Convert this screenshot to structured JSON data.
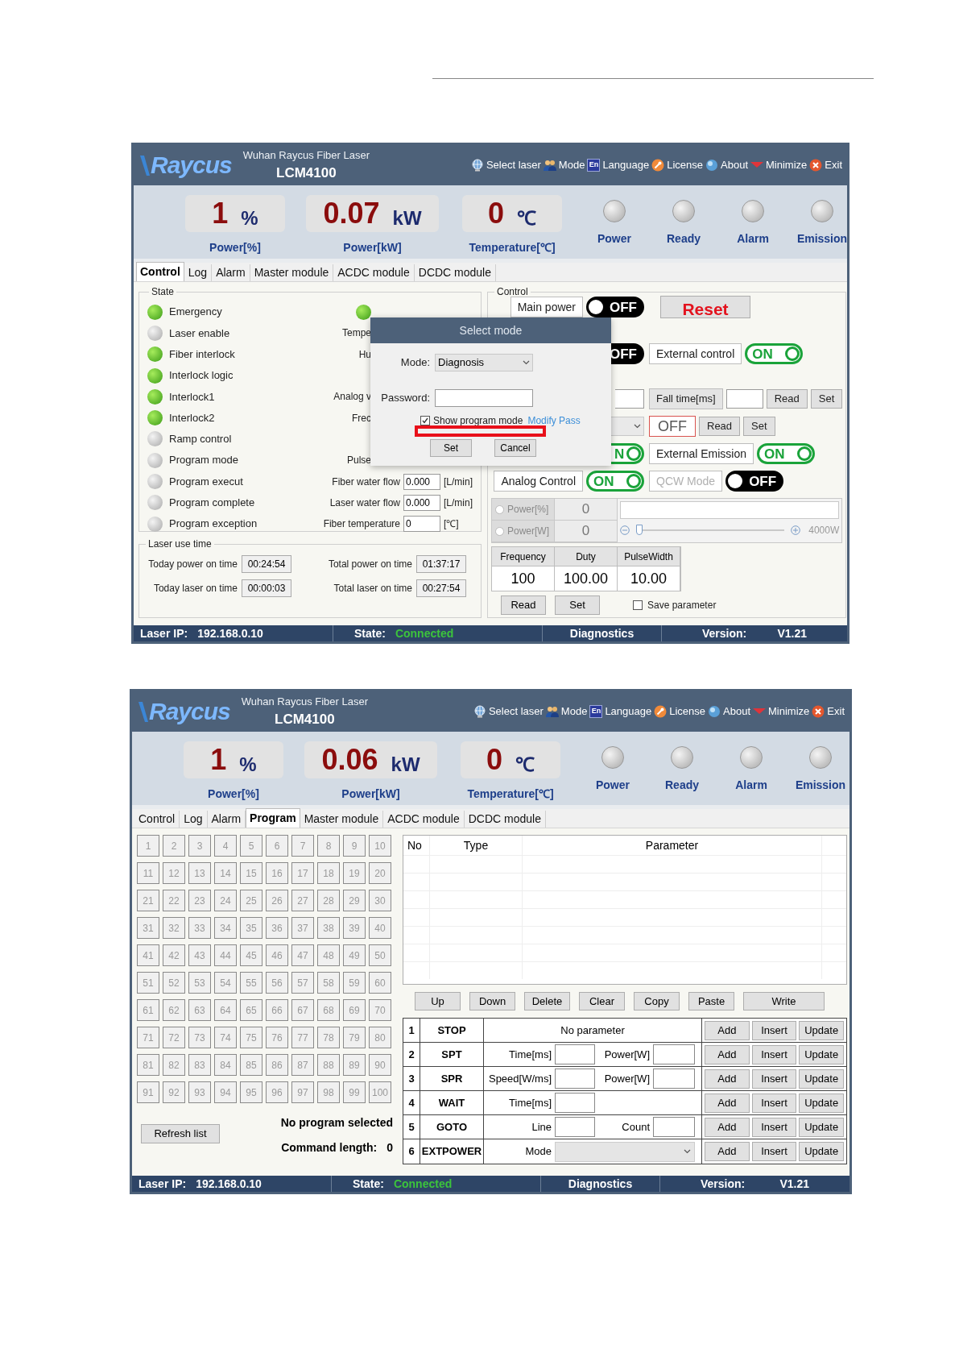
{
  "screens": [
    {
      "kind": "control",
      "header": {
        "logo": "Raycus",
        "company": "Wuhan Raycus Fiber Laser",
        "model": "LCM4100",
        "menu": [
          {
            "label": "Select laser"
          },
          {
            "label": "Mode"
          },
          {
            "label": "Language",
            "icon_text": "En"
          },
          {
            "label": "License"
          },
          {
            "label": "About"
          },
          {
            "label": "Minimize"
          },
          {
            "label": "Exit"
          }
        ]
      },
      "readouts": [
        {
          "value": "1",
          "unit": "%",
          "label": "Power[%]"
        },
        {
          "value": "0.07",
          "unit": "kW",
          "label": "Power[kW]"
        },
        {
          "value": "0",
          "unit": "℃",
          "label": "Temperature[℃]"
        }
      ],
      "lamps": [
        {
          "label": "Power",
          "on": false
        },
        {
          "label": "Ready",
          "on": false
        },
        {
          "label": "Alarm",
          "on": false
        },
        {
          "label": "Emission",
          "on": false
        }
      ],
      "tabs": [
        {
          "label": "Control",
          "selected": true
        },
        {
          "label": "Log",
          "selected": false
        },
        {
          "label": "Alarm",
          "selected": false
        },
        {
          "label": "Master module",
          "selected": false
        },
        {
          "label": "ACDC module",
          "selected": false
        },
        {
          "label": "DCDC module",
          "selected": false
        }
      ],
      "state": {
        "title": "State",
        "indicators": [
          {
            "label": "Emergency",
            "on": true
          },
          {
            "label": "Laser enable",
            "on": false
          },
          {
            "label": "Fiber interlock",
            "on": true
          },
          {
            "label": "Interlock logic",
            "on": true
          },
          {
            "label": "Interlock1",
            "on": true
          },
          {
            "label": "Interlock2",
            "on": true
          },
          {
            "label": "Ramp control",
            "on": false
          },
          {
            "label": "Program mode",
            "on": false
          },
          {
            "label": "Program execut",
            "on": false
          },
          {
            "label": "Program complete",
            "on": false
          },
          {
            "label": "Program exception",
            "on": false
          }
        ],
        "readings": [
          {
            "kind": "lamp",
            "on": true
          },
          {
            "kind": "covered",
            "label": "Tempe"
          },
          {
            "kind": "covered",
            "label": "Hu"
          },
          {
            "kind": "hidden"
          },
          {
            "kind": "covered",
            "label": "Analog v"
          },
          {
            "kind": "covered",
            "label": "Frec"
          },
          {
            "kind": "hidden"
          },
          {
            "kind": "covered",
            "label": "Pulse"
          },
          {
            "kind": "value",
            "label": "Fiber water flow",
            "value": "0.000",
            "unit": "[L/min]"
          },
          {
            "kind": "value",
            "label": "Laser water flow",
            "value": "0.000",
            "unit": "[L/min]"
          },
          {
            "kind": "value",
            "label": "Fiber temperature",
            "value": "0",
            "unit": "[℃]"
          }
        ]
      },
      "usage": {
        "title": "Laser use time",
        "rows": [
          {
            "items": [
              {
                "label": "Today power on time",
                "value": "00:24:54"
              },
              {
                "label": "Total power on time",
                "value": "01:37:17"
              }
            ]
          },
          {
            "items": [
              {
                "label": "Today laser on time",
                "value": "00:00:03"
              },
              {
                "label": "Total laser on time",
                "value": "00:27:54"
              }
            ]
          }
        ]
      },
      "control": {
        "title": "Control",
        "rows": [
          {
            "left": [
              {
                "kind": "label",
                "text": "Main power"
              },
              {
                "kind": "toggle",
                "text": "OFF",
                "on": false
              }
            ],
            "right": [
              {
                "kind": "reset",
                "text": "Reset"
              }
            ]
          },
          {
            "left": [
              {
                "kind": "toggle",
                "text": "OFF",
                "on": false,
                "clipped": true
              }
            ],
            "right": [
              {
                "kind": "label",
                "text": "External control"
              },
              {
                "kind": "toggle",
                "text": "ON",
                "on": true
              }
            ]
          },
          {
            "left": [
              {
                "kind": "field",
                "clipped": true
              }
            ],
            "right": [
              {
                "kind": "caption",
                "text": "Fall time[ms]"
              },
              {
                "kind": "field"
              },
              {
                "kind": "button",
                "text": "Read"
              },
              {
                "kind": "button",
                "text": "Set"
              }
            ]
          },
          {
            "left": [
              {
                "kind": "select",
                "clipped": true
              }
            ],
            "right": [
              {
                "kind": "status",
                "text": "OFF"
              },
              {
                "kind": "button",
                "text": "Read"
              },
              {
                "kind": "button",
                "text": "Set"
              }
            ]
          },
          {
            "left": [
              {
                "kind": "toggle",
                "text": "N",
                "on": true,
                "clipped": true
              }
            ],
            "right": [
              {
                "kind": "label",
                "text": "External Emission"
              },
              {
                "kind": "toggle",
                "text": "ON",
                "on": true
              }
            ]
          },
          {
            "left": [
              {
                "kind": "label",
                "text": "Analog Control"
              },
              {
                "kind": "toggle",
                "text": "ON",
                "on": true
              }
            ],
            "right": [
              {
                "kind": "label",
                "text": "QCW Mode",
                "disabled": true
              },
              {
                "kind": "toggle",
                "text": "OFF",
                "on": false
              }
            ]
          }
        ],
        "power": {
          "modes": [
            {
              "label": "Power[%]",
              "value": "0",
              "selected": false
            },
            {
              "label": "Power[W]",
              "value": "0",
              "selected": false
            }
          ],
          "slider": {
            "level": 0,
            "max_label": "4000W"
          }
        },
        "pulse_table": {
          "columns": [
            "Frequency",
            "Duty",
            "PulseWidth"
          ],
          "values": [
            "100",
            "100.00",
            "10.00"
          ]
        },
        "buttons": [
          "Read",
          "Set"
        ],
        "save": {
          "label": "Save parameter",
          "checked": false
        }
      },
      "dialog": {
        "title": "Select mode",
        "fields": [
          {
            "kind": "select",
            "label": "Mode:",
            "value": "Diagnosis"
          },
          {
            "kind": "password",
            "label": "Password:"
          }
        ],
        "option": {
          "label": "Show program mode",
          "checked": true
        },
        "link": "Modify Pass",
        "buttons": [
          "Set",
          "Cancel"
        ],
        "highlight": true
      },
      "status": [
        {
          "label": "Laser IP:",
          "value": "192.168.0.10"
        },
        {
          "label": "State:",
          "value": "Connected",
          "connected": true
        },
        {
          "value": "Diagnostics"
        },
        {
          "label": "Version:",
          "value": "V1.21"
        }
      ]
    },
    {
      "kind": "program",
      "header": {
        "logo": "Raycus",
        "company": "Wuhan Raycus Fiber Laser",
        "model": "LCM4100",
        "menu": [
          {
            "label": "Select laser"
          },
          {
            "label": "Mode"
          },
          {
            "label": "Language",
            "icon_text": "En"
          },
          {
            "label": "License"
          },
          {
            "label": "About"
          },
          {
            "label": "Minimize"
          },
          {
            "label": "Exit"
          }
        ]
      },
      "readouts": [
        {
          "value": "1",
          "unit": "%",
          "label": "Power[%]"
        },
        {
          "value": "0.06",
          "unit": "kW",
          "label": "Power[kW]"
        },
        {
          "value": "0",
          "unit": "℃",
          "label": "Temperature[℃]"
        }
      ],
      "lamps": [
        {
          "label": "Power",
          "on": false
        },
        {
          "label": "Ready",
          "on": false
        },
        {
          "label": "Alarm",
          "on": false
        },
        {
          "label": "Emission",
          "on": false
        }
      ],
      "tabs": [
        {
          "label": "Control",
          "selected": false
        },
        {
          "label": "Log",
          "selected": false
        },
        {
          "label": "Alarm",
          "selected": false
        },
        {
          "label": "Program",
          "selected": true
        },
        {
          "label": "Master module",
          "selected": false
        },
        {
          "label": "ACDC module",
          "selected": false
        },
        {
          "label": "DCDC module",
          "selected": false
        }
      ],
      "slots": [
        "1",
        "2",
        "3",
        "4",
        "5",
        "6",
        "7",
        "8",
        "9",
        "10",
        "11",
        "12",
        "13",
        "14",
        "15",
        "16",
        "17",
        "18",
        "19",
        "20",
        "21",
        "22",
        "23",
        "24",
        "25",
        "26",
        "27",
        "28",
        "29",
        "30",
        "31",
        "32",
        "33",
        "34",
        "35",
        "36",
        "37",
        "38",
        "39",
        "40",
        "41",
        "42",
        "43",
        "44",
        "45",
        "46",
        "47",
        "48",
        "49",
        "50",
        "51",
        "52",
        "53",
        "54",
        "55",
        "56",
        "57",
        "58",
        "59",
        "60",
        "61",
        "62",
        "63",
        "64",
        "65",
        "66",
        "67",
        "68",
        "69",
        "70",
        "71",
        "72",
        "73",
        "74",
        "75",
        "76",
        "77",
        "78",
        "79",
        "80",
        "81",
        "82",
        "83",
        "84",
        "85",
        "86",
        "87",
        "88",
        "89",
        "90",
        "91",
        "92",
        "93",
        "94",
        "95",
        "96",
        "97",
        "98",
        "99",
        "100"
      ],
      "refresh": "Refresh list",
      "program_status": "No program selected",
      "length_label": "Command length:",
      "length_value": "0",
      "list_columns": [
        "No",
        "Type",
        "Parameter"
      ],
      "list_buttons": [
        "Up",
        "Down",
        "Delete",
        "Clear",
        "Copy",
        "Paste",
        "Write"
      ],
      "commands": [
        {
          "no": "1",
          "type": "STOP",
          "params": [
            {
              "kind": "note",
              "text": "No parameter"
            }
          ],
          "actions": [
            "Add",
            "Insert",
            "Update"
          ]
        },
        {
          "no": "2",
          "type": "SPT",
          "params": [
            {
              "kind": "field",
              "label": "Time[ms]"
            },
            {
              "kind": "field",
              "label": "Power[W]"
            }
          ],
          "actions": [
            "Add",
            "Insert",
            "Update"
          ]
        },
        {
          "no": "3",
          "type": "SPR",
          "params": [
            {
              "kind": "field",
              "label": "Speed[W/ms]"
            },
            {
              "kind": "field",
              "label": "Power[W]"
            }
          ],
          "actions": [
            "Add",
            "Insert",
            "Update"
          ]
        },
        {
          "no": "4",
          "type": "WAIT",
          "params": [
            {
              "kind": "field",
              "label": "Time[ms]"
            }
          ],
          "actions": [
            "Add",
            "Insert",
            "Update"
          ]
        },
        {
          "no": "5",
          "type": "GOTO",
          "params": [
            {
              "kind": "field",
              "label": "Line"
            },
            {
              "kind": "field",
              "label": "Count"
            }
          ],
          "actions": [
            "Add",
            "Insert",
            "Update"
          ]
        },
        {
          "no": "6",
          "type": "EXTPOWER",
          "params": [
            {
              "kind": "select",
              "label": "Mode"
            }
          ],
          "actions": [
            "Add",
            "Insert",
            "Update"
          ]
        }
      ],
      "status": [
        {
          "label": "Laser IP:",
          "value": "192.168.0.10"
        },
        {
          "label": "State:",
          "value": "Connected",
          "connected": true
        },
        {
          "value": "Diagnostics"
        },
        {
          "label": "Version:",
          "value": "V1.21"
        }
      ]
    }
  ]
}
